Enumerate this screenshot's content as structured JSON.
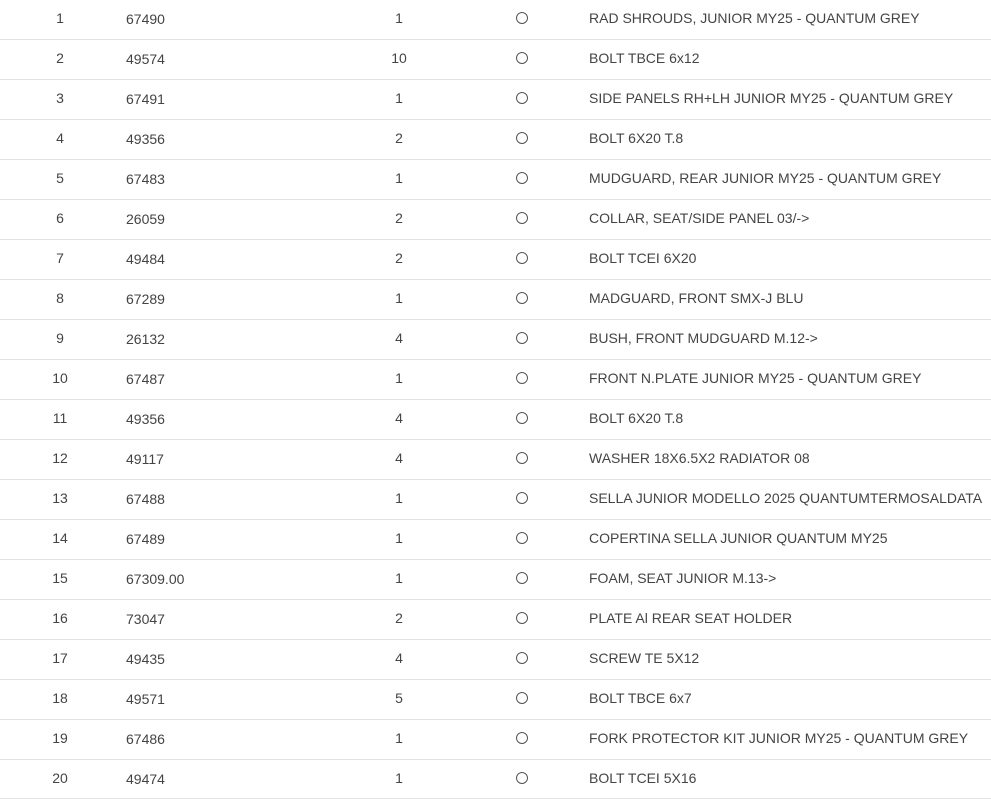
{
  "rows": [
    {
      "pos": "1",
      "code": "67490",
      "qty": "1",
      "desc": "RAD SHROUDS, JUNIOR MY25 - QUANTUM GREY"
    },
    {
      "pos": "2",
      "code": "49574",
      "qty": "10",
      "desc": "BOLT TBCE 6x12"
    },
    {
      "pos": "3",
      "code": "67491",
      "qty": "1",
      "desc": "SIDE PANELS RH+LH JUNIOR MY25 - QUANTUM GREY"
    },
    {
      "pos": "4",
      "code": "49356",
      "qty": "2",
      "desc": "BOLT 6X20 T.8"
    },
    {
      "pos": "5",
      "code": "67483",
      "qty": "1",
      "desc": "MUDGUARD, REAR JUNIOR MY25 - QUANTUM GREY"
    },
    {
      "pos": "6",
      "code": "26059",
      "qty": "2",
      "desc": "COLLAR, SEAT/SIDE PANEL 03/->"
    },
    {
      "pos": "7",
      "code": "49484",
      "qty": "2",
      "desc": "BOLT TCEI 6X20"
    },
    {
      "pos": "8",
      "code": "67289",
      "qty": "1",
      "desc": "MADGUARD, FRONT SMX-J BLU"
    },
    {
      "pos": "9",
      "code": "26132",
      "qty": "4",
      "desc": "BUSH, FRONT MUDGUARD M.12->"
    },
    {
      "pos": "10",
      "code": "67487",
      "qty": "1",
      "desc": "FRONT N.PLATE JUNIOR MY25 - QUANTUM GREY"
    },
    {
      "pos": "11",
      "code": "49356",
      "qty": "4",
      "desc": "BOLT 6X20 T.8"
    },
    {
      "pos": "12",
      "code": "49117",
      "qty": "4",
      "desc": "WASHER 18X6.5X2 RADIATOR 08"
    },
    {
      "pos": "13",
      "code": "67488",
      "qty": "1",
      "desc": "SELLA JUNIOR MODELLO 2025 QUANTUMTERMOSALDATA"
    },
    {
      "pos": "14",
      "code": "67489",
      "qty": "1",
      "desc": "COPERTINA SELLA JUNIOR QUANTUM MY25"
    },
    {
      "pos": "15",
      "code": "67309.00",
      "qty": "1",
      "desc": "FOAM, SEAT JUNIOR M.13->"
    },
    {
      "pos": "16",
      "code": "73047",
      "qty": "2",
      "desc": "PLATE Al REAR SEAT HOLDER"
    },
    {
      "pos": "17",
      "code": "49435",
      "qty": "4",
      "desc": "SCREW TE 5X12"
    },
    {
      "pos": "18",
      "code": "49571",
      "qty": "5",
      "desc": "BOLT TBCE 6x7"
    },
    {
      "pos": "19",
      "code": "67486",
      "qty": "1",
      "desc": "FORK PROTECTOR KIT JUNIOR MY25 - QUANTUM GREY"
    },
    {
      "pos": "20",
      "code": "49474",
      "qty": "1",
      "desc": "BOLT TCEI 5X16"
    }
  ]
}
